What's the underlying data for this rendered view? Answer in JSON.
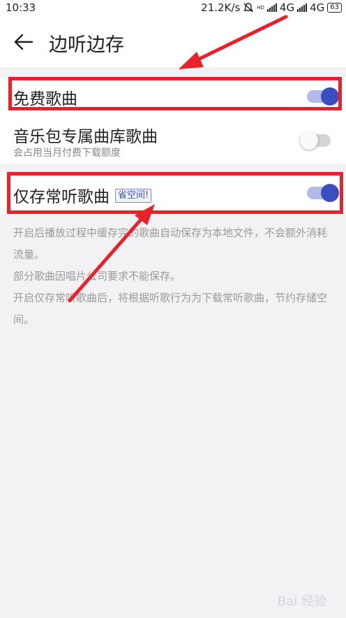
{
  "status_bar": {
    "time": "10:33",
    "net_speed": "21.2K/s",
    "network1": "4G",
    "network2": "4G",
    "hd_label": "HD",
    "battery": "63"
  },
  "header": {
    "title": "边听边存"
  },
  "settings": {
    "free_songs": {
      "label": "免费歌曲",
      "enabled": true
    },
    "music_package": {
      "label": "音乐包专属曲库歌曲",
      "subtitle": "会占用当月付费下载额度",
      "enabled": false
    },
    "frequent_only": {
      "label": "仅存常听歌曲",
      "badge": "省空间!",
      "enabled": true
    }
  },
  "description": {
    "line1": "开启后播放过程中缓存完的歌曲自动保存为本地文件，不会额外消耗流量。",
    "line2": "部分歌曲因唱片公司要求不能保存。",
    "line3": "开启仅存常听歌曲后，将根据听歌行为为下载常听歌曲，节约存储空间。"
  },
  "watermark": "Bai 经验",
  "colors": {
    "accent": "#3a4ec0",
    "accent_track": "#b4bae8",
    "annotation_red": "#e8212b"
  }
}
